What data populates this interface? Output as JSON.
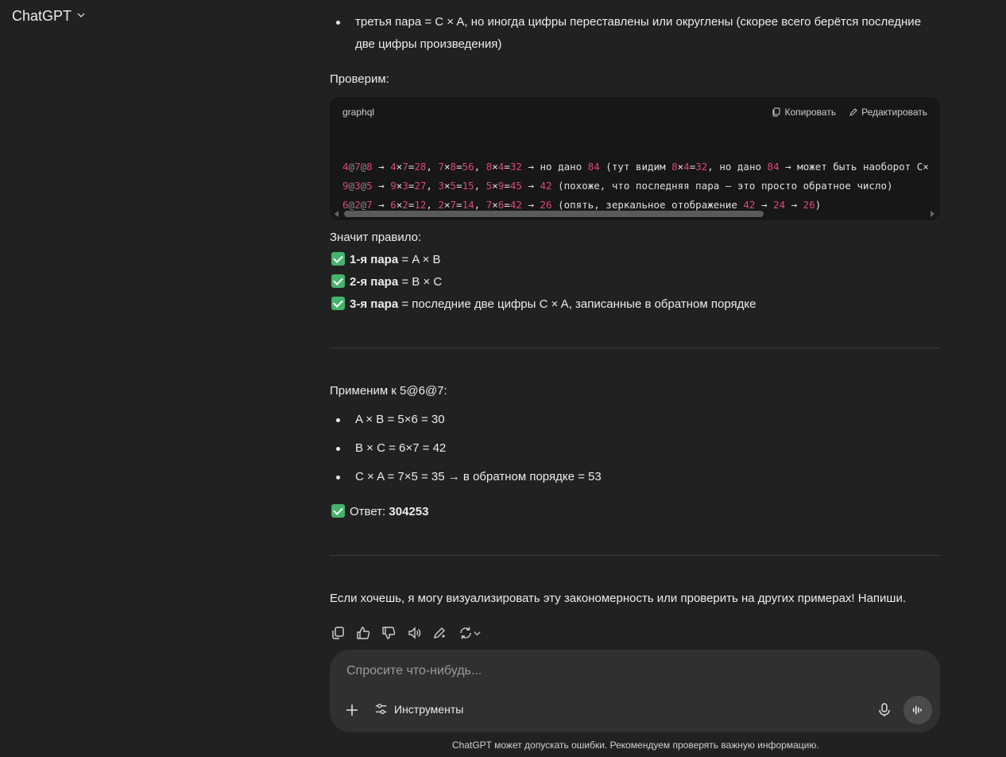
{
  "header": {
    "title": "ChatGPT"
  },
  "message": {
    "bullet_third": "третья пара = C × A, но иногда цифры переставлены или округлены (скорее всего берётся последние две цифры произведения)",
    "check_intro": "Проверим:",
    "code": {
      "lang": "graphql",
      "copy_label": "Копировать",
      "edit_label": "Редактировать",
      "lines": [
        "4@7@8 → 4×7=28, 7×8=56, 8×4=32 → но дано 84 (тут видим 8×4=32, но дано 84 → может быть наоборот C×",
        "9@3@5 → 9×3=27, 3×5=15, 5×9=45 → 42 (похоже, что последняя пара — это просто обратное число)",
        "6@2@7 → 6×2=12, 2×7=14, 7×6=42 → 26 (опять, зеркальное отображение 42 → 24 → 26)"
      ]
    },
    "rule_intro": "Значит правило:",
    "rules": [
      {
        "bold": "1-я пара",
        "text": " = A × B"
      },
      {
        "bold": "2-я пара",
        "text": " = B × C"
      },
      {
        "bold": "3-я пара",
        "text": " = последние две цифры C × A, записанные в обратном порядке"
      }
    ],
    "apply_intro": "Применим к 5@6@7:",
    "apply_items": [
      "A × B = 5×6 = 30",
      "B × C = 6×7 = 42",
      "C × A = 7×5 = 35 → в обратном порядке = 53"
    ],
    "answer_label": "Ответ: ",
    "answer_value": "304253",
    "closing": "Если хочешь, я могу визуализировать эту закономерность или проверить на других примерах! Напиши."
  },
  "composer": {
    "placeholder": "Спросите что-нибудь...",
    "tools_label": "Инструменты"
  },
  "footer": {
    "disclaimer": "ChatGPT может допускать ошибки. Рекомендуем проверять важную информацию."
  }
}
